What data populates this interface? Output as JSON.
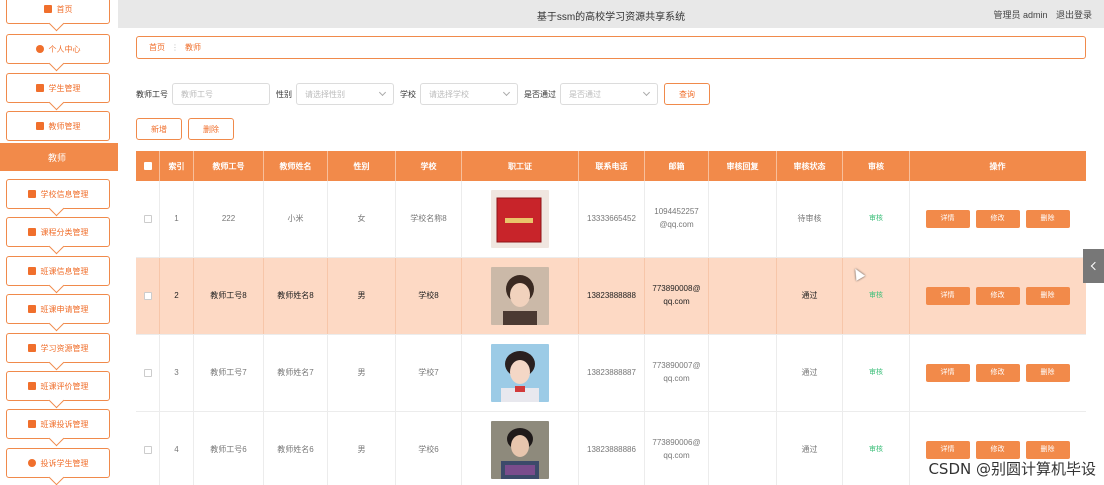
{
  "app": {
    "title": "基于ssm的高校学习资源共享系统",
    "user_label": "管理员 admin",
    "logout": "退出登录"
  },
  "sidebar": {
    "items": [
      {
        "label": "首页",
        "icon": "home-icon"
      },
      {
        "label": "个人中心",
        "icon": "user-icon"
      },
      {
        "label": "学生管理",
        "icon": "grid-icon"
      },
      {
        "label": "教师管理",
        "icon": "briefcase-icon"
      },
      {
        "label": "学校信息管理",
        "icon": "grid-icon"
      },
      {
        "label": "课程分类管理",
        "icon": "message-icon"
      },
      {
        "label": "班课信息管理",
        "icon": "grid-icon"
      },
      {
        "label": "班课申请管理",
        "icon": "grid-icon"
      },
      {
        "label": "学习资源管理",
        "icon": "grid-icon"
      },
      {
        "label": "班课评价管理",
        "icon": "thumbs-up-icon"
      },
      {
        "label": "班课投诉管理",
        "icon": "grid-icon"
      },
      {
        "label": "投诉学生管理",
        "icon": "user-icon"
      }
    ],
    "active_sub": "教师"
  },
  "breadcrumb": {
    "home": "首页",
    "current": "教师"
  },
  "search": {
    "teacher_no_label": "教师工号",
    "teacher_no_placeholder": "教师工号",
    "gender_label": "性别",
    "gender_placeholder": "请选择性别",
    "school_label": "学校",
    "school_placeholder": "请选择学校",
    "pass_label": "是否通过",
    "pass_placeholder": "是否通过",
    "query_button": "查询"
  },
  "actions": {
    "add": "新增",
    "delete": "删除"
  },
  "table": {
    "headers": [
      "",
      "索引",
      "教师工号",
      "教师姓名",
      "性别",
      "学校",
      "职工证",
      "联系电话",
      "邮箱",
      "审核回复",
      "审核状态",
      "审核",
      "操作"
    ],
    "rows": [
      {
        "index": "1",
        "teacher_no": "222",
        "name": "小米",
        "gender": "女",
        "school": "学校名称8",
        "phone": "13333665452",
        "email_1": "1094452257",
        "email_2": "@qq.com",
        "reply": "",
        "status": "待审核",
        "audit": "审核",
        "photo": "red-certificate"
      },
      {
        "index": "2",
        "teacher_no": "教师工号8",
        "name": "教师姓名8",
        "gender": "男",
        "school": "学校8",
        "phone": "13823888888",
        "email_1": "773890008@",
        "email_2": "qq.com",
        "reply": "",
        "status": "通过",
        "audit": "审核",
        "photo": "portrait-1"
      },
      {
        "index": "3",
        "teacher_no": "教师工号7",
        "name": "教师姓名7",
        "gender": "男",
        "school": "学校7",
        "phone": "13823888887",
        "email_1": "773890007@",
        "email_2": "qq.com",
        "reply": "",
        "status": "通过",
        "audit": "审核",
        "photo": "portrait-2"
      },
      {
        "index": "4",
        "teacher_no": "教师工号6",
        "name": "教师姓名6",
        "gender": "男",
        "school": "学校6",
        "phone": "13823888886",
        "email_1": "773890006@",
        "email_2": "qq.com",
        "reply": "",
        "status": "通过",
        "audit": "审核",
        "photo": "portrait-3"
      }
    ],
    "op_labels": {
      "detail": "详情",
      "edit": "修改",
      "delete": "删除"
    }
  },
  "watermark": "CSDN @别圆计算机毕设",
  "colors": {
    "accent": "#f28a4a",
    "accent_text": "#f06f2c",
    "row_highlight": "#fdd9c4",
    "pass": "#3cbf7a"
  }
}
